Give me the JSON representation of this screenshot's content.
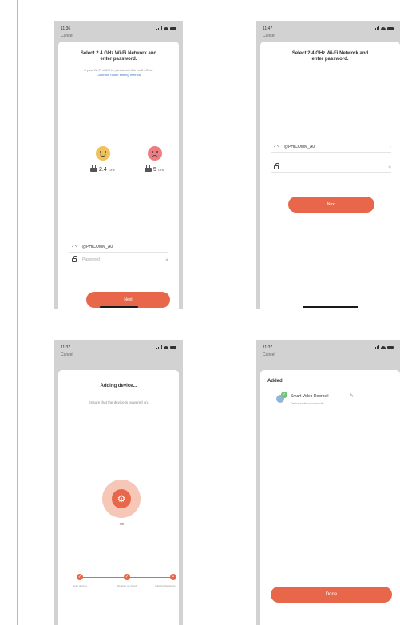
{
  "screens": {
    "screen1": {
      "time": "11:36",
      "cancel": "Cancel",
      "title_line1": "Select 2.4 GHz Wi-Fi Network and",
      "title_line2": "enter password.",
      "hint": "If your Wi-Fi is 5GHz, please set it to be 2.4GHz.",
      "hint_link": "Common router setting method",
      "band_24": "2.4",
      "band_24_unit": "GHz",
      "band_5": "5",
      "band_5_unit": "GHz",
      "ssid": "@PHICOMM_A0",
      "password_placeholder": "Password",
      "next": "Next"
    },
    "screen2": {
      "time": "11:47",
      "cancel": "Cancel",
      "title_line1": "Select 2.4 GHz Wi-Fi Network and",
      "title_line2": "enter password.",
      "ssid": "@PHICOMM_A0",
      "password_value": "",
      "next": "Next"
    },
    "screen3": {
      "time": "11:37",
      "cancel": "Cancel",
      "title": "Adding device...",
      "subtitle": "Ensure that the device is powered on.",
      "percent": "7%",
      "steps": [
        "Scan devices",
        "Register on Cloud",
        "Initialize the device"
      ]
    },
    "screen4": {
      "time": "11:37",
      "cancel": "Cancel",
      "added": "Added.",
      "device_name": "Smart Video Doorbell",
      "device_status": "Device added successfully",
      "done": "Done"
    }
  },
  "colors": {
    "accent": "#e8674a",
    "accent_light": "#f6c7b6",
    "phone_bg": "#d2d2d2",
    "link": "#3f76c9",
    "success": "#6fc27a"
  },
  "icons": [
    "signal-icon",
    "wifi-icon",
    "battery-icon",
    "happy-face-icon",
    "sad-face-icon",
    "router-icon",
    "lock-icon",
    "gear-icon",
    "check-icon",
    "camera-icon",
    "pencil-icon"
  ]
}
